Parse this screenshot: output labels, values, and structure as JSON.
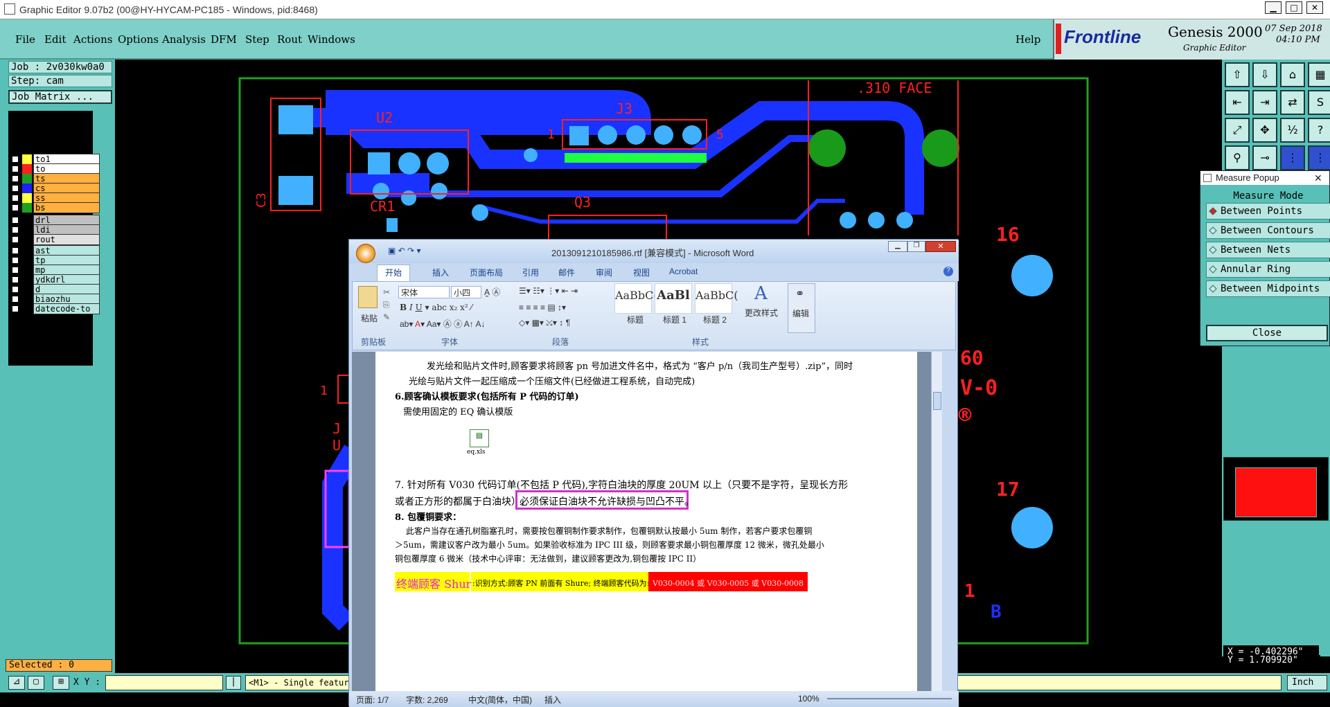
{
  "window": {
    "title": "Graphic Editor 9.07b2 (00@HY-HYCAM-PC185 - Windows, pid:8468)"
  },
  "menu": {
    "items": [
      "File",
      "Edit",
      "Actions",
      "Options",
      "Analysis",
      "DFM",
      "Step",
      "Rout",
      "Windows"
    ],
    "help": "Help"
  },
  "brand": {
    "logo": "Frontline",
    "product": "Genesis 2000",
    "subtitle": "Graphic Editor",
    "date": "07 Sep 2018",
    "time": "04:10 PM"
  },
  "job": {
    "job": "Job : 2v030kw0a0",
    "step": "Step: cam",
    "matrix": "Job Matrix ..."
  },
  "layers": [
    {
      "name": "to1",
      "color": "#ffff40",
      "bg": "#ffffff"
    },
    {
      "name": "to",
      "color": "#ff2020",
      "bg": "#ffffff"
    },
    {
      "name": "ts",
      "color": "#20a020",
      "bg": "#ffb040"
    },
    {
      "name": "cs",
      "color": "#2020ff",
      "bg": "#ffb040"
    },
    {
      "name": "ss",
      "color": "#ffff40",
      "bg": "#ffb040"
    },
    {
      "name": "bs",
      "color": "#20a020",
      "bg": "#ffb040"
    },
    {
      "name": "drl",
      "color": "",
      "bg": "#c0c0c0"
    },
    {
      "name": "ldi",
      "color": "",
      "bg": "#c0c0c0"
    },
    {
      "name": "rout",
      "color": "",
      "bg": "#e0e0e0"
    },
    {
      "name": "ast",
      "color": "",
      "bg": "#b8e6e0"
    },
    {
      "name": "tp",
      "color": "",
      "bg": "#b8e6e0"
    },
    {
      "name": "mp",
      "color": "",
      "bg": "#b8e6e0"
    },
    {
      "name": "ydkdrl",
      "color": "",
      "bg": "#b8e6e0"
    },
    {
      "name": "d",
      "color": "",
      "bg": "#b8e6e0"
    },
    {
      "name": "biaozhu",
      "color": "",
      "bg": "#b8e6e0"
    },
    {
      "name": "datecode-to",
      "color": "",
      "bg": "#b8e6e0"
    }
  ],
  "selected": "Selected : 0",
  "bottom": {
    "xy_label": "X Y :",
    "xy_value": "",
    "mode": "<M1> - Single feature",
    "unit": "Inch"
  },
  "measure": {
    "title": "Measure Popup",
    "header": "Measure Mode",
    "options": [
      "Between Points",
      "Between Contours",
      "Between Nets",
      "Annular Ring",
      "Between Midpoints"
    ],
    "selected": "Between Points",
    "close": "Close"
  },
  "coords": {
    "x": "X = -0.402296\"",
    "y": "Y = 1.709920\""
  },
  "canvas_labels": {
    "u2": "U2",
    "j3": "J3",
    "q3": "Q3",
    "cr1": "CR1",
    "c3": "C3",
    "face": ".310 FACE",
    "n1": "1",
    "n5": "5",
    "n16": "16",
    "n17": "17",
    "n60": "60",
    "v0": "V-0",
    "b": "B",
    "j": "J",
    "one": "1",
    "u": "U",
    "r": "®",
    "d1": "1"
  },
  "word": {
    "title": "2013091210185986.rtf [兼容模式] - Microsoft Word",
    "tabs": [
      "开始",
      "插入",
      "页面布局",
      "引用",
      "邮件",
      "审阅",
      "视图",
      "Acrobat"
    ],
    "font": "宋体",
    "size": "小四",
    "styles": [
      {
        "sample": "AaBbC(",
        "name": "标题"
      },
      {
        "sample": "AaBl",
        "name": "标题 1"
      },
      {
        "sample": "AaBbC(",
        "name": "标题 2"
      }
    ],
    "paste": "粘贴",
    "change_styles": "更改样式",
    "edit": "编辑",
    "groups": [
      "剪贴板",
      "字体",
      "段落",
      "样式"
    ],
    "lines": [
      "发光绘和贴片文件时,顾客要求将顾客 pn 号加进文件名中，格式为 “客户 p/n（我司生产型号）.zip”，同时",
      "光绘与贴片文件一起压缩成一个压缩文件(已经做进工程系统，自动完成)",
      "6.顾客确认模板要求(包括所有 P 代码的订单)",
      "需使用固定的 EQ 确认模版",
      "eq.xls",
      "7. 针对所有 V030 代码订单(不包括 P 代码),字符白油块的厚度 20UM 以上（只要不是字符，呈现长方形",
      "或者正方形的都属于白油块）,",
      "必须保证白油块不允许缺损与凹凸不平。",
      "8. 包覆铜要求：",
      "此客户当存在通孔树脂塞孔时，需要按包覆铜制作要求制作，包覆铜默认按最小 5um 制作，若客户要求包覆铜",
      "＞5um，需建议客户改为最小 5um。如果验收标准为 IPC III 级，则顾客要求最小铜包覆厚度 12 微米，微孔处最小",
      "铜包覆厚度 6 微米（技术中心评审：无法做到，建议顾客更改为,铜包覆按 IPC II）",
      "终端顾客 Shure",
      ":识别方式:顾客 PN 前面有 Shure; 终端顾客代码为:",
      "V030-0004 或 V030-0005 或 V030-0008"
    ],
    "status": {
      "page": "页面: 1/7",
      "words": "字数: 2,269",
      "lang": "中文(简体，中国)",
      "mode": "插入",
      "zoom": "100%"
    }
  }
}
